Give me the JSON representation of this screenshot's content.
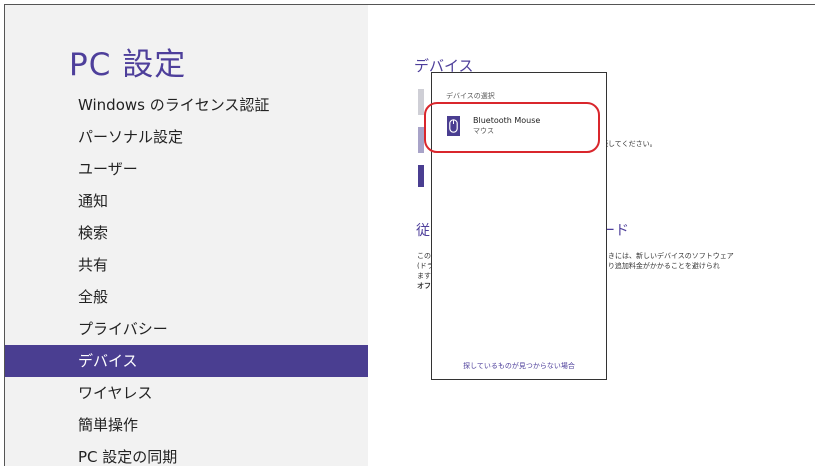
{
  "sidebar": {
    "title": "PC 設定",
    "items": [
      {
        "label": "Windows のライセンス認証"
      },
      {
        "label": "パーソナル設定"
      },
      {
        "label": "ユーザー"
      },
      {
        "label": "通知"
      },
      {
        "label": "検索"
      },
      {
        "label": "共有"
      },
      {
        "label": "全般"
      },
      {
        "label": "プライバシー"
      },
      {
        "label": "デバイス",
        "selected": true
      },
      {
        "label": "ワイヤレス"
      },
      {
        "label": "簡単操作"
      },
      {
        "label": "PC 設定の同期"
      }
    ]
  },
  "main": {
    "section_title": "デバイス",
    "instruction_fragment": "続してください。",
    "update_heading_left": "従",
    "update_heading_right": "ード",
    "desc_left_lines": [
      "この",
      "(ドラ",
      "ます"
    ],
    "desc_left_bold": "オフ",
    "desc_right_lines": [
      "ときには、新しいデバイスのソフトウェア",
      "より追加料金がかかることを避けられ"
    ]
  },
  "flyout": {
    "header": "デバイスの選択",
    "device": {
      "name": "Bluetooth Mouse",
      "type": "マウス",
      "icon": "mouse-icon"
    },
    "help_link": "探しているものが見つからない場合"
  },
  "colors": {
    "accent": "#4a3e91",
    "title": "#4e3f9b",
    "sidebar_bg": "#f2f2f2",
    "highlight": "#d9262c"
  }
}
